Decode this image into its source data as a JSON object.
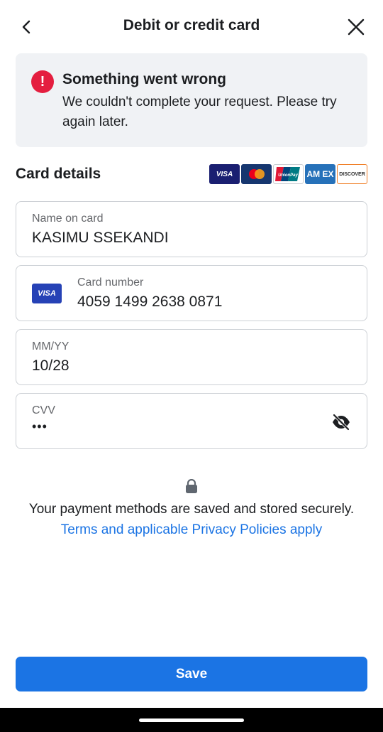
{
  "header": {
    "title": "Debit or credit card",
    "back_icon": "chevron-left-icon",
    "close_icon": "close-icon"
  },
  "alert": {
    "icon": "exclamation-icon",
    "icon_glyph": "!",
    "title": "Something went wrong",
    "message": "We couldn't complete your request. Please try again later.",
    "color": "#e41e3f"
  },
  "card_details": {
    "title": "Card details",
    "brands": [
      "VISA",
      "Mastercard",
      "UnionPay",
      "AMEX",
      "DISCOVER"
    ],
    "brand_labels": {
      "visa": "VISA",
      "unionpay": "UnionPay",
      "amex": "AM EX",
      "discover": "DISCOVER"
    }
  },
  "fields": {
    "name": {
      "label": "Name on card",
      "value": "KASIMU SSEKANDI"
    },
    "card_number": {
      "label": "Card number",
      "value": "4059 1499 2638 0871",
      "brand": "VISA"
    },
    "expiry": {
      "label": "MM/YY",
      "value": "10/28"
    },
    "cvv": {
      "label": "CVV",
      "value": "•••",
      "toggle_icon": "eye-off-icon"
    }
  },
  "security": {
    "icon": "lock-icon",
    "text": "Your payment methods are saved and stored securely.",
    "link": "Terms and applicable Privacy Policies apply"
  },
  "actions": {
    "save_label": "Save"
  },
  "colors": {
    "accent": "#1b74e4",
    "error": "#e41e3f",
    "alert_bg": "#f0f2f5"
  }
}
